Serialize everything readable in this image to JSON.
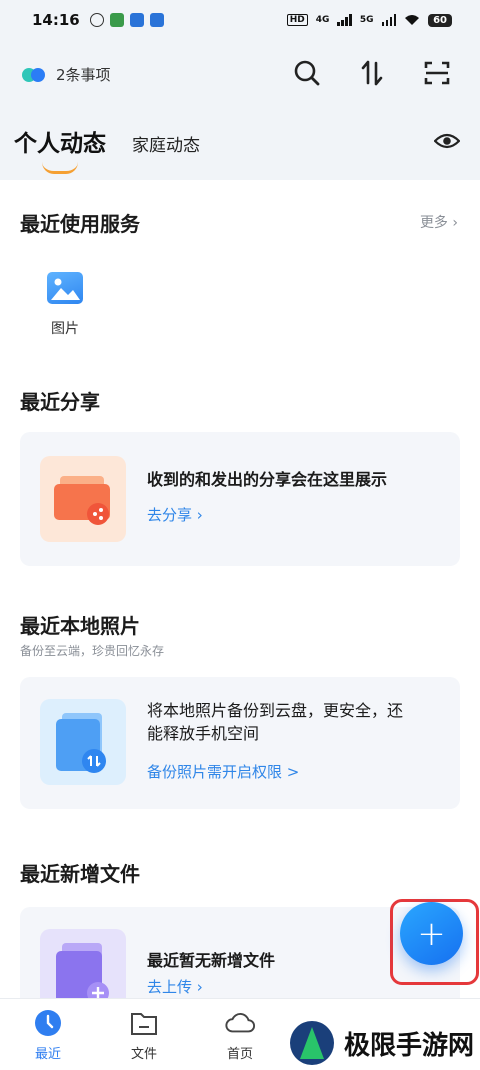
{
  "status_bar": {
    "time": "14:16",
    "network_labels": [
      "HD",
      "4G",
      "5G"
    ],
    "battery": "60"
  },
  "header": {
    "todo_label": "2条事项",
    "tabs": [
      {
        "label": "个人动态",
        "active": true
      },
      {
        "label": "家庭动态",
        "active": false
      }
    ],
    "icons": [
      "search-icon",
      "sort-icon",
      "scan-icon",
      "eye-icon"
    ]
  },
  "recent_services": {
    "title": "最近使用服务",
    "more_label": "更多",
    "items": [
      {
        "label": "图片",
        "icon": "image-icon"
      }
    ]
  },
  "recent_share": {
    "title": "最近分享",
    "message": "收到的和发出的分享会在这里展示",
    "link": "去分享 ›"
  },
  "local_photos": {
    "title": "最近本地照片",
    "subtitle": "备份至云端，珍贵回忆永存",
    "message_line1": "将本地照片备份到云盘，更安全，还",
    "message_line2": "能释放手机空间",
    "link": "备份照片需开启权限 >"
  },
  "new_files": {
    "title": "最近新增文件",
    "message": "最近暂无新增文件",
    "link": "去上传 ›"
  },
  "fab": {
    "label": "+"
  },
  "bottom_nav": [
    {
      "label": "最近",
      "icon": "clock-icon",
      "active": true
    },
    {
      "label": "文件",
      "icon": "folder-icon",
      "active": false
    },
    {
      "label": "首页",
      "icon": "cloud-icon",
      "active": false
    }
  ],
  "watermark": {
    "text": "极限手游网"
  },
  "colors": {
    "accent": "#2f7ef0",
    "header_bg": "#f1f4f8",
    "card_bg": "#f4f6fa",
    "highlight_border": "#e5383b"
  }
}
